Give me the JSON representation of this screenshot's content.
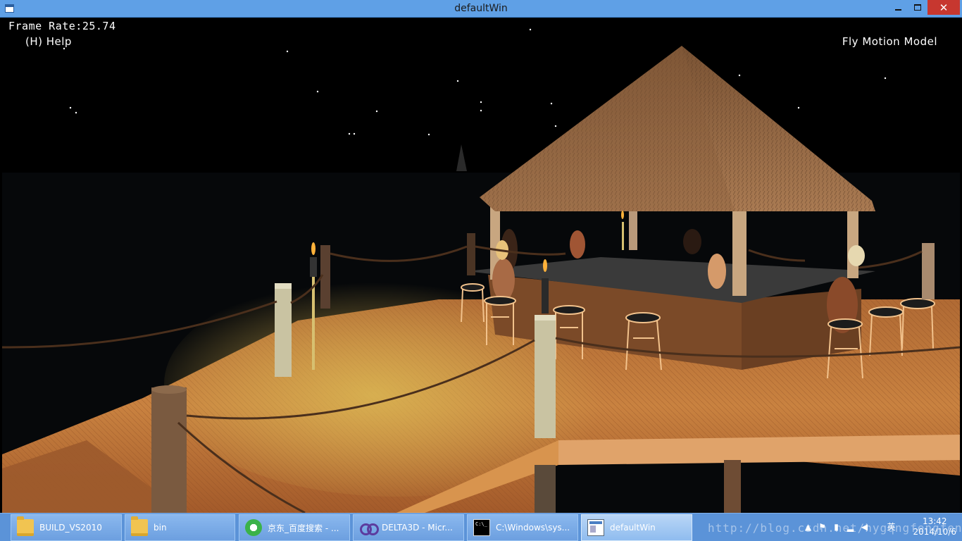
{
  "window": {
    "title": "defaultWin",
    "minimize_label": "minimize",
    "maximize_label": "maximize",
    "close_glyph": "✕"
  },
  "hud": {
    "frame_rate": "Frame Rate:25.74",
    "help": "(H) Help",
    "motion_model": "Fly Motion Model"
  },
  "taskbar": {
    "items": [
      {
        "label": "BUILD_VS2010",
        "icon": "folder-icon"
      },
      {
        "label": "bin",
        "icon": "folder-icon"
      },
      {
        "label": "京东_百度搜索 - ...",
        "icon": "browser-icon"
      },
      {
        "label": "DELTA3D - Micr...",
        "icon": "visual-studio-icon"
      },
      {
        "label": "C:\\Windows\\sys...",
        "icon": "command-prompt-icon"
      },
      {
        "label": "defaultWin",
        "icon": "application-window-icon"
      }
    ],
    "active_index": 5
  },
  "tray": {
    "time": "13:42",
    "date": "2014/10/6",
    "ime": "英"
  },
  "watermark": "http://blog.csdn.net/hygqngfengfen",
  "colors": {
    "titlebar": "#5fa0e6",
    "taskbar": "#5b93d8",
    "close_button": "#c7372f",
    "deck": "#c9773a",
    "night_sky": "#000000"
  }
}
